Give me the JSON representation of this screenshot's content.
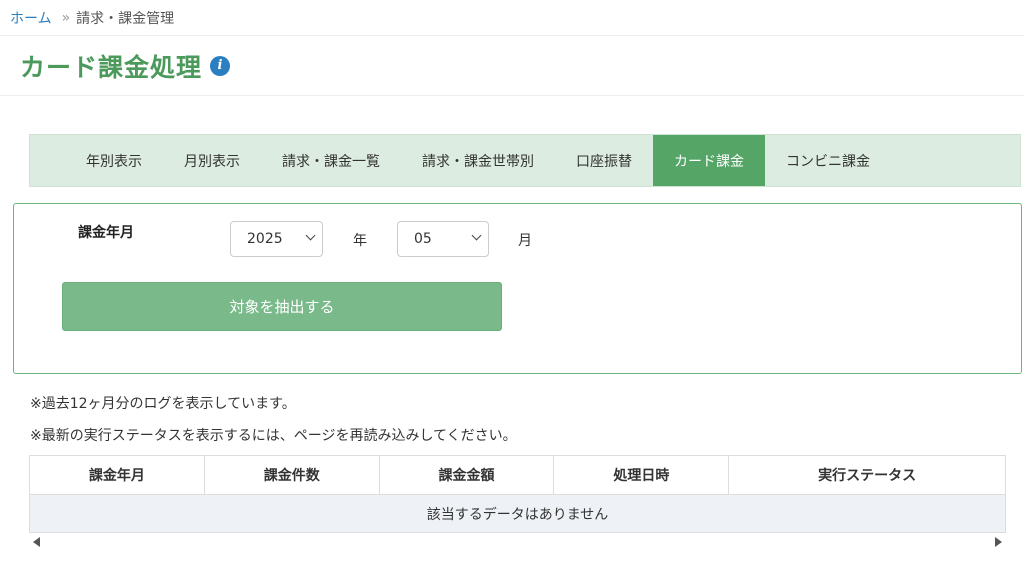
{
  "breadcrumb": {
    "home": "ホーム",
    "separator": "»",
    "current": "請求・課金管理"
  },
  "page": {
    "title": "カード課金処理",
    "info_icon": "i"
  },
  "tabs": [
    {
      "label": "年別表示"
    },
    {
      "label": "月別表示"
    },
    {
      "label": "請求・課金一覧"
    },
    {
      "label": "請求・課金世帯別"
    },
    {
      "label": "口座振替"
    },
    {
      "label": "カード課金",
      "active": true
    },
    {
      "label": "コンビニ課金"
    }
  ],
  "form": {
    "billing_month_label": "課金年月",
    "year_value": "2025",
    "year_unit": "年",
    "month_value": "05",
    "month_unit": "月",
    "extract_button": "対象を抽出する"
  },
  "notes": {
    "line1": "※過去12ヶ月分のログを表示しています。",
    "line2": "※最新の実行ステータスを表示するには、ページを再読み込みしてください。"
  },
  "table": {
    "headers": [
      "課金年月",
      "課金件数",
      "課金金額",
      "処理日時",
      "実行ステータス"
    ],
    "empty_message": "該当するデータはありません"
  },
  "colors": {
    "accent": "#4b9a5c",
    "tab_active": "#55a567",
    "button": "#79b98a",
    "link": "#2a7fc1"
  }
}
